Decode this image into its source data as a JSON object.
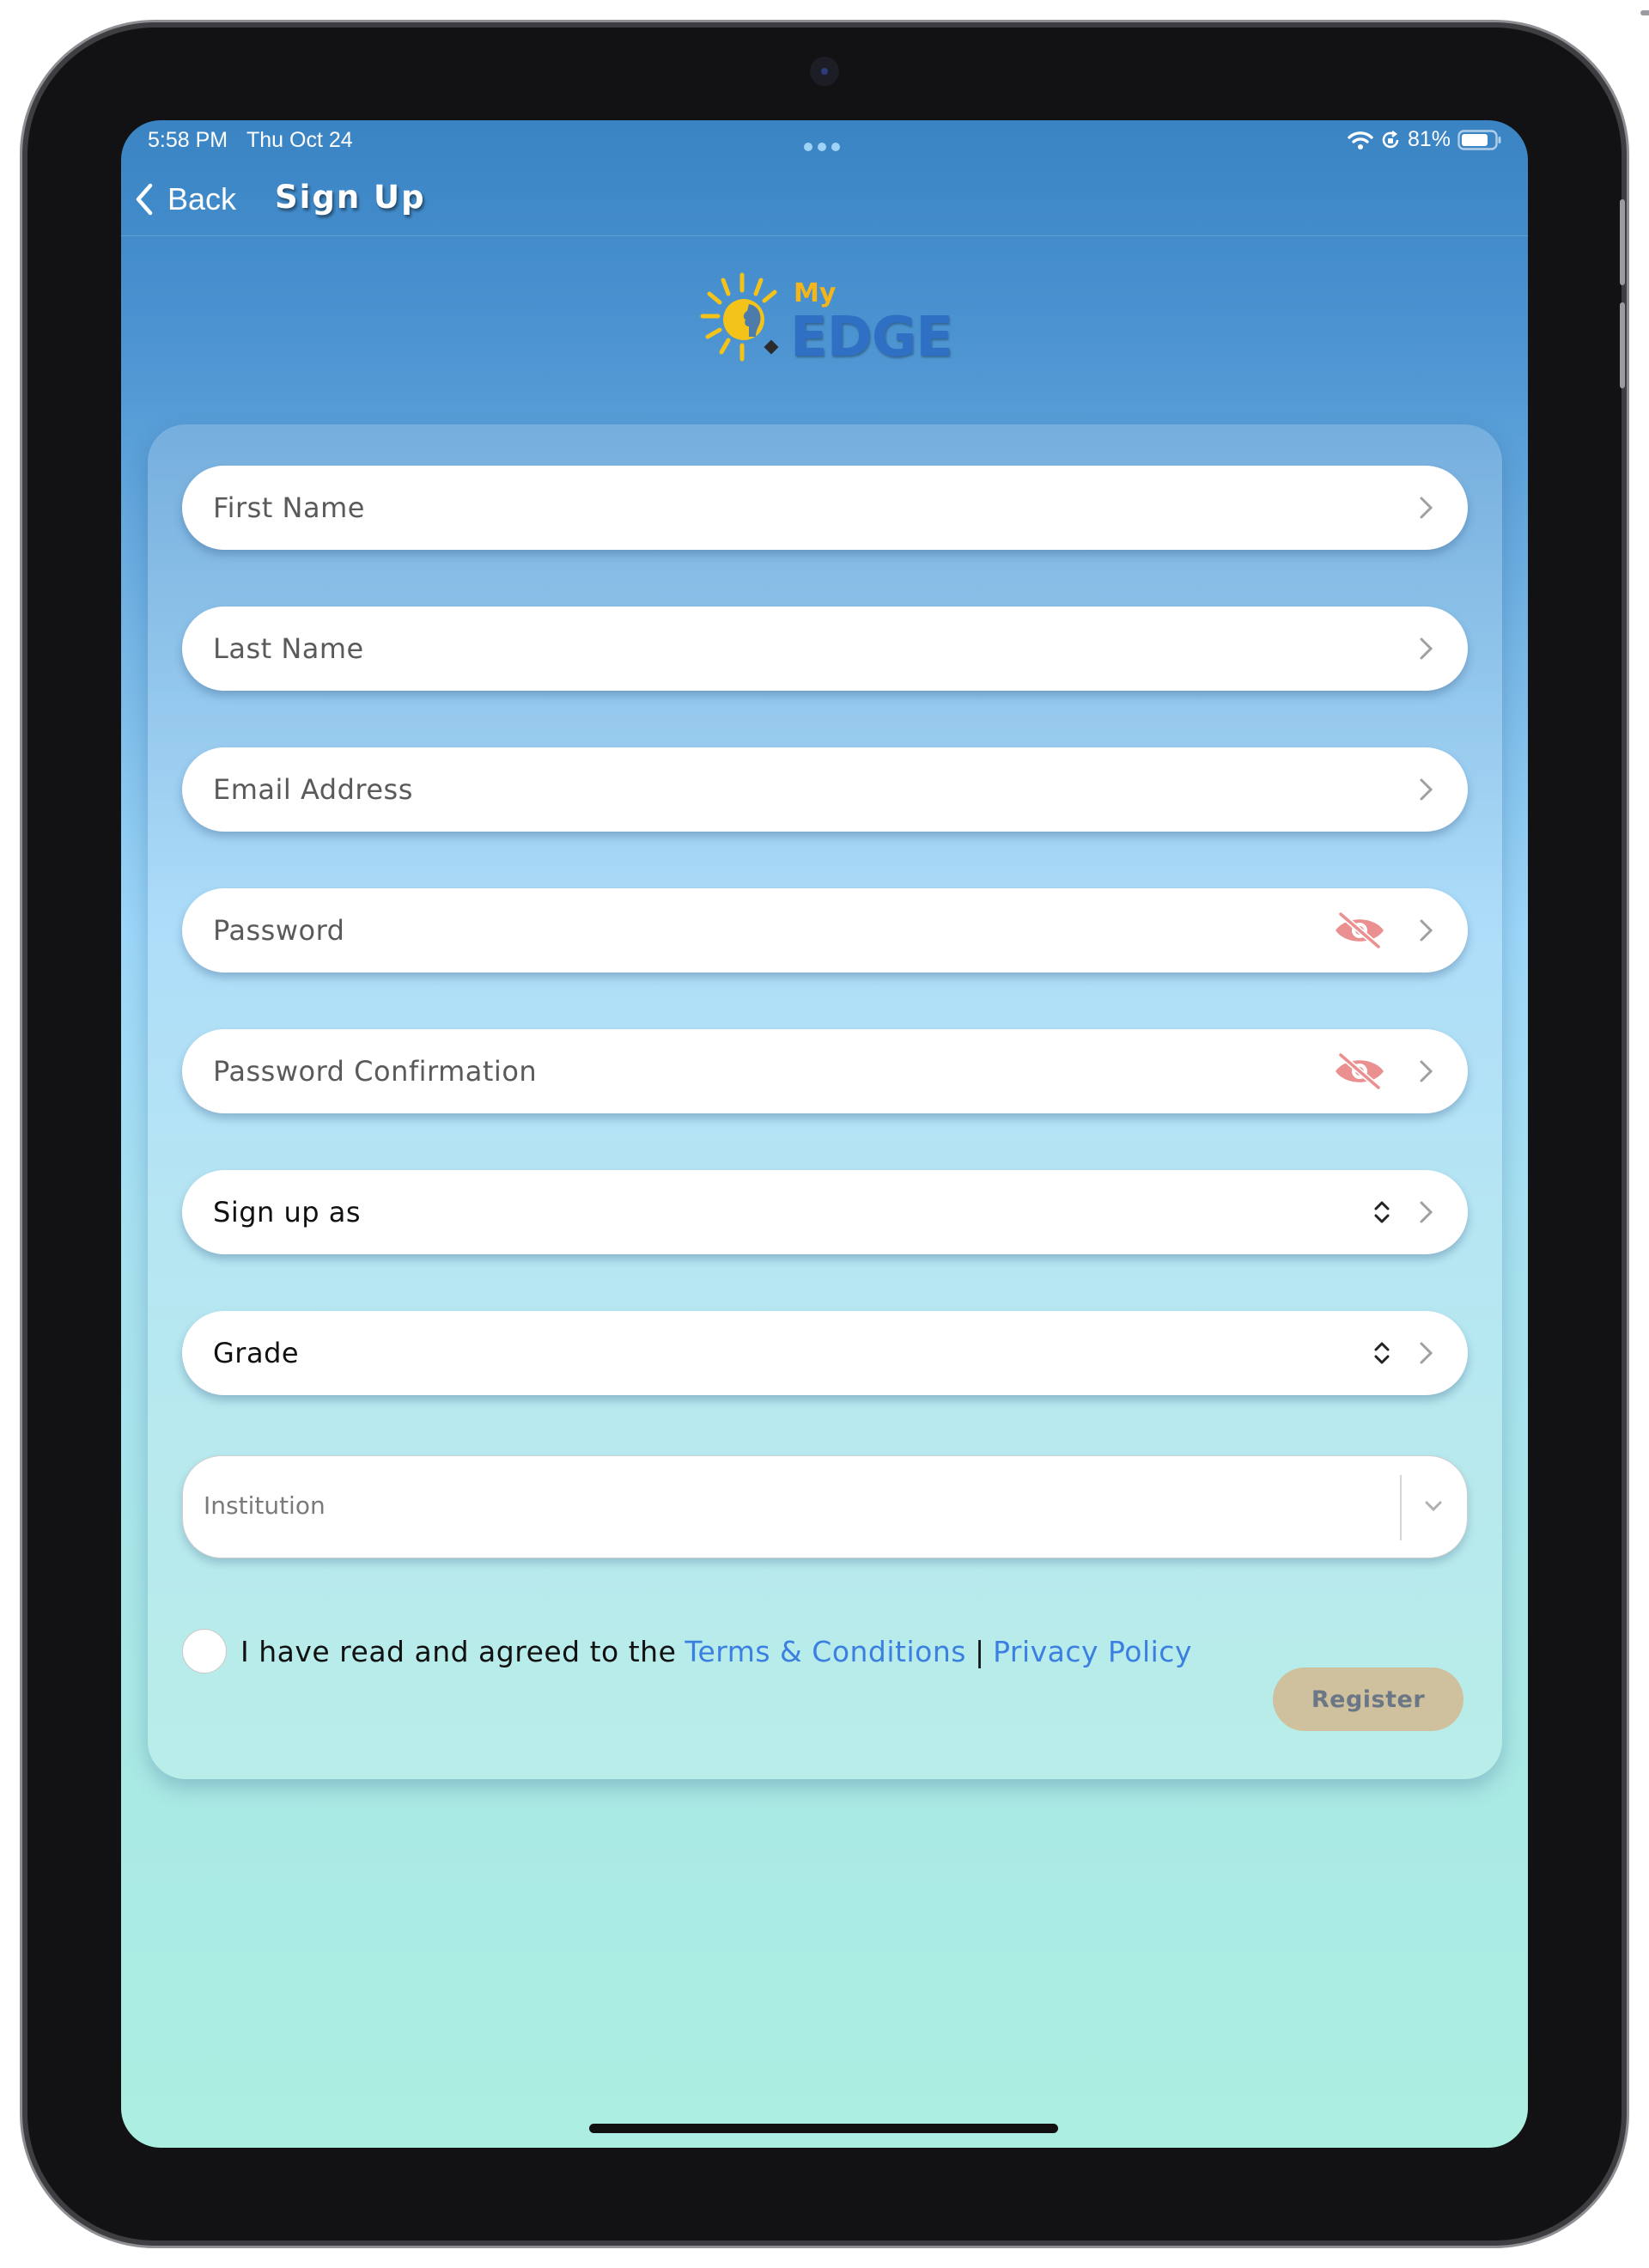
{
  "status_bar": {
    "time": "5:58 PM",
    "date": "Thu Oct 24",
    "multitask_dots": "•••",
    "battery_percent": "81%",
    "battery_level": 0.81,
    "icons": [
      "wifi-icon",
      "orientation-lock-icon",
      "battery-icon"
    ]
  },
  "nav": {
    "back_label": "Back",
    "title": "Sign Up"
  },
  "logo": {
    "line1": "My",
    "line2": "EDGE"
  },
  "form": {
    "first_name": "First Name",
    "last_name": "Last Name",
    "email": "Email Address",
    "password": "Password",
    "password_confirmation": "Password Confirmation",
    "sign_up_as": "Sign up as",
    "grade": "Grade",
    "institution": "Institution"
  },
  "agreement": {
    "text": "I have read and agreed to the",
    "terms_link": "Terms & Conditions",
    "separator": "|",
    "privacy_link": "Privacy Policy",
    "checked": false
  },
  "register_label": "Register",
  "colors": {
    "link": "#3b7fe0",
    "register_bg": "#cfc19d",
    "eye_off_icon": "#e88a8a",
    "gradient_top": "#3a84c4",
    "gradient_bottom": "#aceee2"
  }
}
